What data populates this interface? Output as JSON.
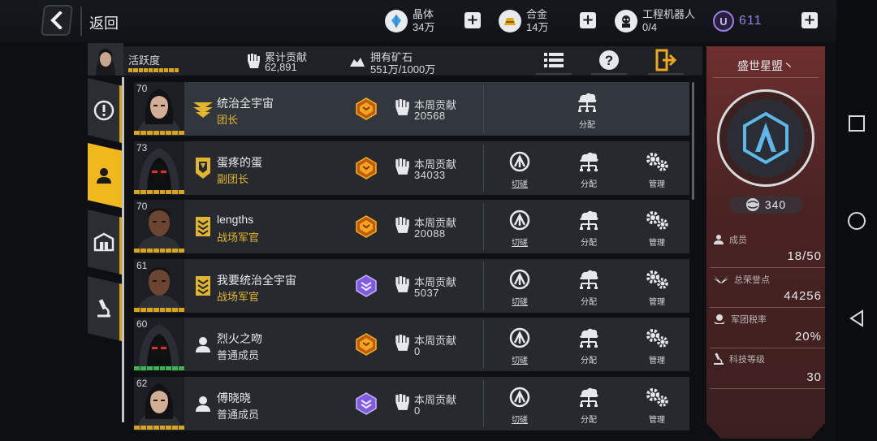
{
  "header": {
    "back_label": "返回",
    "resources": [
      {
        "name": "晶体",
        "value": "34万",
        "icon": "crystal-icon",
        "color": "#3ea0e8"
      },
      {
        "name": "合金",
        "value": "14万",
        "icon": "alloy-icon",
        "color": "#e6a519"
      },
      {
        "name": "工程机器人",
        "value": "0/4",
        "icon": "robot-icon",
        "color": "#e8e8e8"
      }
    ],
    "currency": {
      "value": "611",
      "badge": "U",
      "color": "#9d7fe6"
    },
    "cart_badge": "!"
  },
  "infobar": {
    "activity_label": "活跃度",
    "total_contrib_label": "累计贡献",
    "total_contrib_value": "62,891",
    "ore_label": "拥有矿石",
    "ore_value": "551万/1000万"
  },
  "members": [
    {
      "level": "70",
      "name": "统治全宇宙",
      "role": "团长",
      "role_color": "gold",
      "rank_icon": "leader-rank-icon",
      "medal": "gold",
      "contrib_label": "本周贡献",
      "contrib": "20568",
      "actions": [
        "分配"
      ],
      "lvbar": "gold",
      "face": "female"
    },
    {
      "level": "73",
      "name": "蛋疼的蛋",
      "role": "副团长",
      "role_color": "gold",
      "rank_icon": "vice-rank-icon",
      "medal": "gold",
      "contrib_label": "本周贡献",
      "contrib": "34033",
      "actions": [
        "切磋",
        "分配",
        "管理"
      ],
      "lvbar": "gold",
      "face": "hood"
    },
    {
      "level": "70",
      "name": "lengths",
      "role": "战场军官",
      "role_color": "gold",
      "rank_icon": "officer-rank-icon",
      "medal": "gold",
      "contrib_label": "本周贡献",
      "contrib": "20088",
      "actions": [
        "切磋",
        "分配",
        "管理"
      ],
      "lvbar": "gold",
      "face": "male"
    },
    {
      "level": "61",
      "name": "我要统治全宇宙",
      "role": "战场军官",
      "role_color": "gold",
      "rank_icon": "officer-rank-icon",
      "medal": "purple",
      "contrib_label": "本周贡献",
      "contrib": "5037",
      "actions": [
        "切磋",
        "分配",
        "管理"
      ],
      "lvbar": "gold",
      "face": "male"
    },
    {
      "level": "60",
      "name": "烈火之吻",
      "role": "普通成员",
      "role_color": "plain",
      "rank_icon": "member-icon",
      "medal": "gold",
      "contrib_label": "本周贡献",
      "contrib": "0",
      "actions": [
        "切磋",
        "分配",
        "管理"
      ],
      "lvbar": "green",
      "face": "hood"
    },
    {
      "level": "62",
      "name": "傅晓晓",
      "role": "普通成员",
      "role_color": "plain",
      "rank_icon": "member-icon",
      "medal": "purple",
      "contrib_label": "本周贡献",
      "contrib": "0",
      "actions": [
        "切磋",
        "分配",
        "管理"
      ],
      "lvbar": "gold",
      "face": "female"
    }
  ],
  "alliance": {
    "name": "盛世星盟丶",
    "points": "340",
    "stats": [
      {
        "label": "成员",
        "value": "18/50",
        "icon": "members-icon"
      },
      {
        "label": "总荣誉点",
        "value": "44256",
        "icon": "wings-icon"
      },
      {
        "label": "军团税率",
        "value": "20%",
        "icon": "tax-icon"
      },
      {
        "label": "科技等级",
        "value": "30",
        "icon": "microscope-icon"
      }
    ]
  },
  "colors": {
    "accent": "#d9a514",
    "panel": "#6e2f2f"
  }
}
